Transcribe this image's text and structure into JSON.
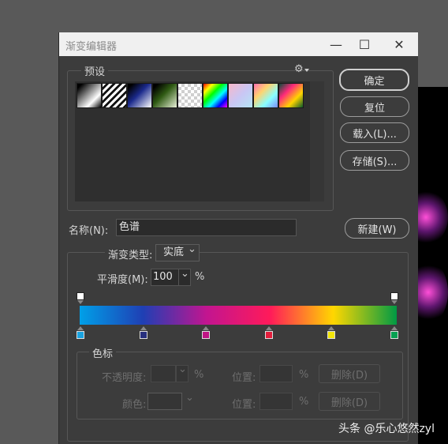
{
  "dialog": {
    "title": "渐变编辑器",
    "minimize_glyph": "—",
    "maximize_glyph": "☐",
    "close_glyph": "✕"
  },
  "presets": {
    "legend": "预设",
    "gear_glyph": "⚙",
    "swatches": [
      {
        "name": "foreground-to-background",
        "css": "linear-gradient(135deg,#000 10%,#fff 70%,#000 100%)"
      },
      {
        "name": "foreground-to-transparent",
        "css": "repeating-linear-gradient(135deg,#fff 0 3px,#111 3px 6px)"
      },
      {
        "name": "black-white",
        "css": "linear-gradient(135deg,#000 10%,#1b2a8c 45%,#fff 100%)"
      },
      {
        "name": "green",
        "css": "linear-gradient(135deg,#000 10%,#2f5a13 45%,#e8f0d8 100%)"
      },
      {
        "name": "transparent-stripes",
        "css": "repeating-conic-gradient(#cfcfcf 0 25%,#fff 0 50%) 0 0/8px 8px"
      },
      {
        "name": "spectrum-1",
        "css": "linear-gradient(135deg,#f00,#ff0,#0f0,#0ff,#00f,#f0f)"
      },
      {
        "name": "pastel",
        "css": "linear-gradient(135deg,#f7b7c9,#c9c6f4,#b4e4f4)"
      },
      {
        "name": "spectrum-2",
        "css": "linear-gradient(135deg,#ff6fb0,#ffd36f,#8ff,#7b8cff)"
      },
      {
        "name": "spectrum-3",
        "css": "linear-gradient(135deg,#0a4a3a,#ff2a7a,#ffd400,#0a5a2a)"
      }
    ]
  },
  "buttons": {
    "ok": "确定",
    "reset": "复位",
    "load": "载入(L)...",
    "save": "存储(S)...",
    "new": "新建(W)"
  },
  "name_row": {
    "label": "名称(N):",
    "value": "色谱"
  },
  "gradient_type": {
    "label": "渐变类型:",
    "value": "实底",
    "chevron": "⌄"
  },
  "smoothness": {
    "label": "平滑度(M):",
    "value": "100",
    "unit": "%",
    "chevron": "⌄"
  },
  "gradient_bar": {
    "css": "linear-gradient(90deg,#00a0e8 0%,#1f3fb4 20%,#c21590 40%,#ff1a5a 60%,#ffd700 80%,#009a44 100%)",
    "color_stops": [
      "#1aa3e0",
      "#28307e",
      "#c01584",
      "#e31e3c",
      "#f3e60a",
      "#08a052"
    ]
  },
  "stops_section": {
    "legend": "色标",
    "opacity_label": "不透明度:",
    "opacity_unit": "%",
    "position_label": "位置:",
    "position_unit": "%",
    "delete_label": "删除(D)",
    "color_label": "颜色:",
    "position_label_2": "位置:",
    "position_unit_2": "%",
    "delete_label_2": "删除(D)",
    "chevron": "⌄"
  },
  "watermark": "头条 @乐心悠然zyl"
}
